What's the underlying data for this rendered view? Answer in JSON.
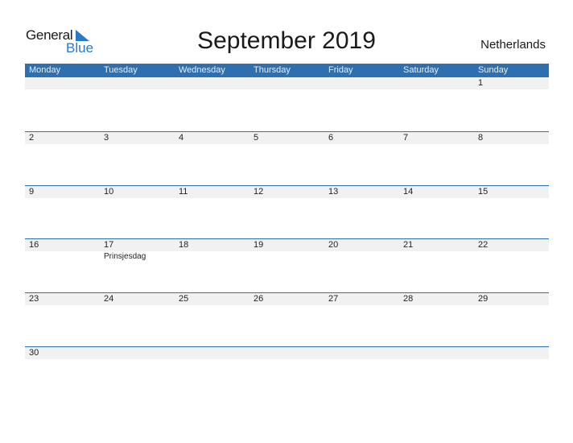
{
  "logo": {
    "line1": "General",
    "line2": "Blue"
  },
  "title": "September 2019",
  "country": "Netherlands",
  "weekdays": [
    "Monday",
    "Tuesday",
    "Wednesday",
    "Thursday",
    "Friday",
    "Saturday",
    "Sunday"
  ],
  "weeks": [
    {
      "days": [
        "",
        "",
        "",
        "",
        "",
        "",
        "1"
      ],
      "events": [
        "",
        "",
        "",
        "",
        "",
        "",
        ""
      ]
    },
    {
      "days": [
        "2",
        "3",
        "4",
        "5",
        "6",
        "7",
        "8"
      ],
      "events": [
        "",
        "",
        "",
        "",
        "",
        "",
        ""
      ]
    },
    {
      "days": [
        "9",
        "10",
        "11",
        "12",
        "13",
        "14",
        "15"
      ],
      "events": [
        "",
        "",
        "",
        "",
        "",
        "",
        ""
      ]
    },
    {
      "days": [
        "16",
        "17",
        "18",
        "19",
        "20",
        "21",
        "22"
      ],
      "events": [
        "",
        "Prinsjesdag",
        "",
        "",
        "",
        "",
        ""
      ]
    },
    {
      "days": [
        "23",
        "24",
        "25",
        "26",
        "27",
        "28",
        "29"
      ],
      "events": [
        "",
        "",
        "",
        "",
        "",
        "",
        ""
      ]
    },
    {
      "days": [
        "30",
        "",
        "",
        "",
        "",
        "",
        ""
      ],
      "events": [
        "",
        "",
        "",
        "",
        "",
        "",
        ""
      ]
    }
  ],
  "colors": {
    "header": "#2e6fb0",
    "accent": "#2a78c8",
    "day_row": "#f1f1f1"
  }
}
